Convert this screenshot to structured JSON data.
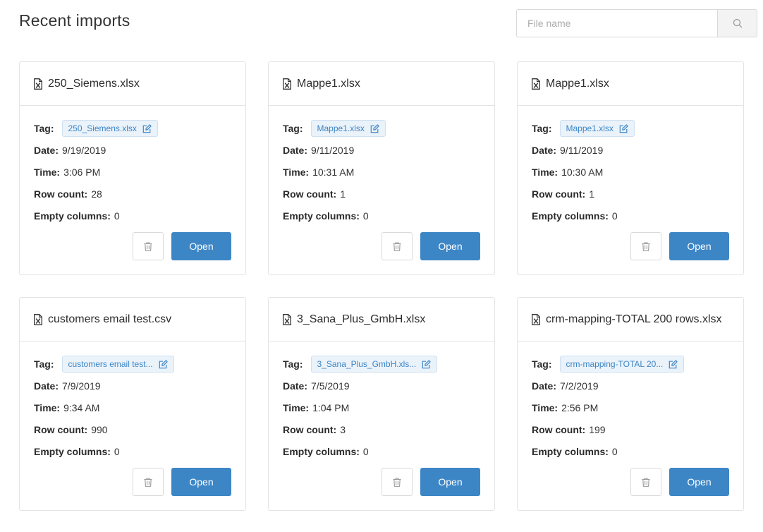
{
  "page": {
    "title": "Recent imports"
  },
  "search": {
    "placeholder": "File name",
    "value": ""
  },
  "labels": {
    "tag": "Tag:",
    "date": "Date:",
    "time": "Time:",
    "row_count": "Row count:",
    "empty_columns": "Empty columns:",
    "open": "Open"
  },
  "icons": {
    "file": "file-excel-icon",
    "edit": "edit-icon",
    "delete": "trash-icon",
    "search": "search-icon"
  },
  "colors": {
    "accent": "#3d86c6",
    "tag_bg": "#eaf2fa"
  },
  "imports": [
    {
      "name": "250_Siemens.xlsx",
      "tag": "250_Siemens.xlsx",
      "date": "9/19/2019",
      "time": "3:06 PM",
      "row_count": "28",
      "empty_columns": "0"
    },
    {
      "name": "Mappe1.xlsx",
      "tag": "Mappe1.xlsx",
      "date": "9/11/2019",
      "time": "10:31 AM",
      "row_count": "1",
      "empty_columns": "0"
    },
    {
      "name": "Mappe1.xlsx",
      "tag": "Mappe1.xlsx",
      "date": "9/11/2019",
      "time": "10:30 AM",
      "row_count": "1",
      "empty_columns": "0"
    },
    {
      "name": "customers email test.csv",
      "tag": "customers email test...",
      "date": "7/9/2019",
      "time": "9:34 AM",
      "row_count": "990",
      "empty_columns": "0"
    },
    {
      "name": "3_Sana_Plus_GmbH.xlsx",
      "tag": "3_Sana_Plus_GmbH.xls...",
      "date": "7/5/2019",
      "time": "1:04 PM",
      "row_count": "3",
      "empty_columns": "0"
    },
    {
      "name": "crm-mapping-TOTAL 200 rows.xlsx",
      "tag": "crm-mapping-TOTAL 20...",
      "date": "7/2/2019",
      "time": "2:56 PM",
      "row_count": "199",
      "empty_columns": "0"
    }
  ]
}
